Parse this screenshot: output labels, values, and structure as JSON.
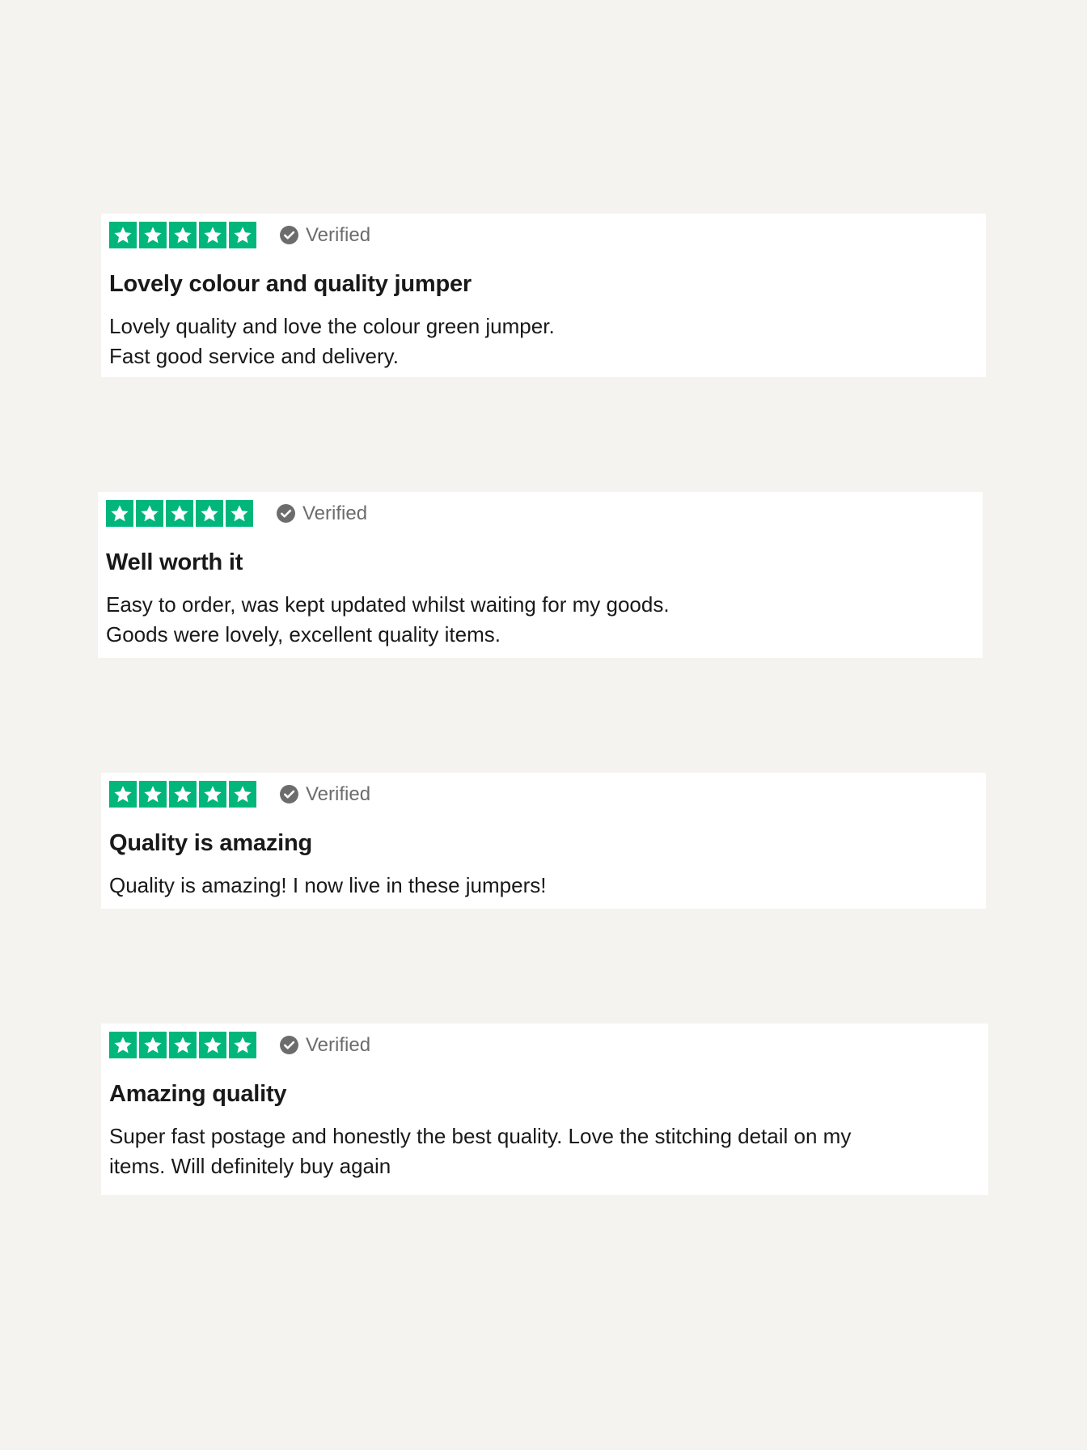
{
  "colors": {
    "page_background": "#f4f3ef",
    "card_background": "#ffffff",
    "star_green": "#00b67a",
    "verified_gray": "#6c6c6c"
  },
  "reviews": [
    {
      "rating": 5,
      "verified_label": "Verified",
      "title": "Lovely colour and quality jumper",
      "body_lines": [
        "Lovely quality and love the colour green jumper.",
        "Fast good service and delivery."
      ]
    },
    {
      "rating": 5,
      "verified_label": "Verified",
      "title": "Well worth it",
      "body_lines": [
        "Easy to order, was kept updated whilst waiting for my goods.",
        "Goods were lovely, excellent quality items."
      ]
    },
    {
      "rating": 5,
      "verified_label": "Verified",
      "title": "Quality is amazing",
      "body_lines": [
        "Quality is amazing! I now live in these jumpers!"
      ]
    },
    {
      "rating": 5,
      "verified_label": "Verified",
      "title": "Amazing quality",
      "body_lines": [
        "Super fast postage and honestly the best quality. Love the stitching detail on my",
        "items. Will definitely buy again"
      ]
    }
  ]
}
